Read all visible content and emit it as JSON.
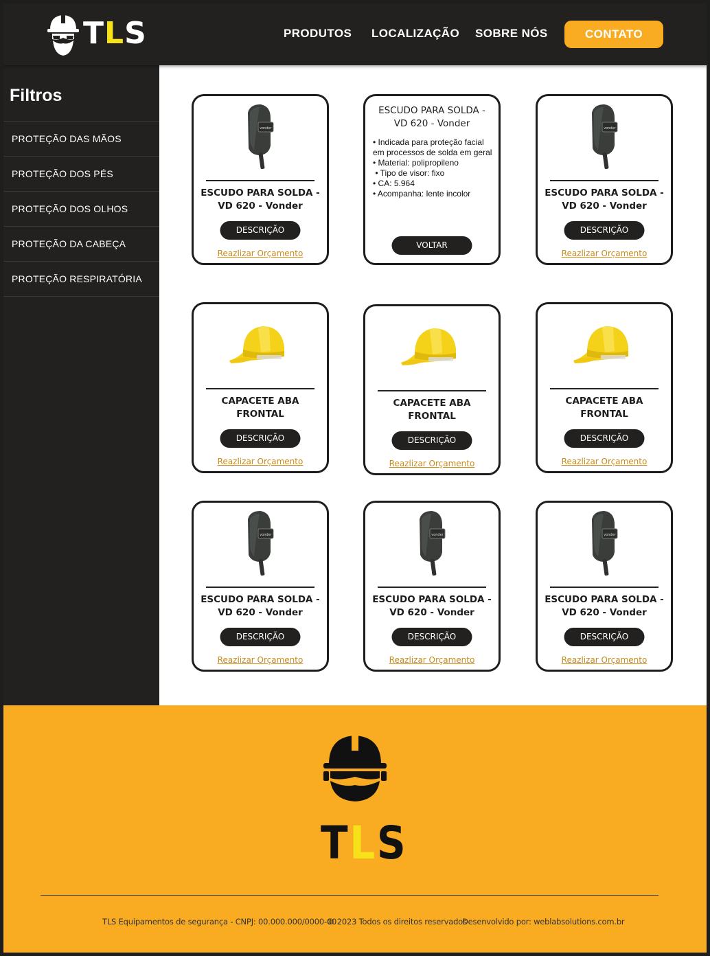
{
  "brand": {
    "logo_prefix": "T",
    "logo_highlight": "L",
    "logo_suffix": "S"
  },
  "nav": {
    "produtos": "PRODUTOS",
    "localizacao": "LOCALIZAÇÃO",
    "sobre": "SOBRE NÓS",
    "contato": "CONTATO"
  },
  "sidebar": {
    "title": "Filtros",
    "items": [
      {
        "label": "PROTEÇÃO DAS MÃOS"
      },
      {
        "label": "PROTEÇÃO DOS PÉS"
      },
      {
        "label": "PROTEÇÃO DOS OLHOS"
      },
      {
        "label": "PROTEÇÃO DA CABEÇA"
      },
      {
        "label": "PROTEÇÃO RESPIRATÓRIA"
      }
    ]
  },
  "products": [
    {
      "title": "ESCUDO PARA SOLDA - VD 620 - Vonder",
      "icon": "welding-shield-icon",
      "button": "DESCRIÇÃO",
      "link": "Reazlizar Orçamento"
    },
    {
      "title": "ESCUDO PARA SOLDA - VD 620 - Vonder",
      "details": [
        "• Indicada para proteção facial em processos de solda em geral",
        "• Material: polipropileno",
        " • Tipo de visor: fixo",
        "• CA: 5.964",
        "• Acompanha: lente incolor"
      ],
      "button": "VOLTAR"
    },
    {
      "title": "ESCUDO PARA SOLDA - VD 620 - Vonder",
      "icon": "welding-shield-icon",
      "button": "DESCRIÇÃO",
      "link": "Reazlizar Orçamento"
    },
    {
      "title": "CAPACETE ABA FRONTAL",
      "icon": "hard-hat-icon",
      "button": "DESCRIÇÃO",
      "link": "Reazlizar Orçamento"
    },
    {
      "title": "CAPACETE ABA FRONTAL",
      "icon": "hard-hat-icon",
      "button": "DESCRIÇÃO",
      "link": "Reazlizar Orçamento"
    },
    {
      "title": "CAPACETE ABA FRONTAL",
      "icon": "hard-hat-icon",
      "button": "DESCRIÇÃO",
      "link": "Reazlizar Orçamento"
    },
    {
      "title": "ESCUDO PARA SOLDA - VD 620 - Vonder",
      "icon": "welding-shield-icon",
      "button": "DESCRIÇÃO",
      "link": "Reazlizar Orçamento"
    },
    {
      "title": "ESCUDO PARA SOLDA - VD 620 - Vonder",
      "icon": "welding-shield-icon",
      "button": "DESCRIÇÃO",
      "link": "Reazlizar Orçamento"
    },
    {
      "title": "ESCUDO PARA SOLDA - VD 620 - Vonder",
      "icon": "welding-shield-icon",
      "button": "DESCRIÇÃO",
      "link": "Reazlizar Orçamento"
    }
  ],
  "shield_brand": "vonder",
  "footer": {
    "logo_prefix": "T",
    "logo_highlight": "L",
    "logo_suffix": "S",
    "company": "TLS Equipamentos de segurança - CNPJ: 00.000.000/0000-00",
    "copyright": "© 2023 Todos os direitos reservados",
    "developer": "Desenvolvido por: weblabsolutions.com.br"
  },
  "colors": {
    "dark": "#222120",
    "accent": "#f9ab22",
    "logo_highlight": "#f7e21a",
    "link": "#c98b1a"
  }
}
